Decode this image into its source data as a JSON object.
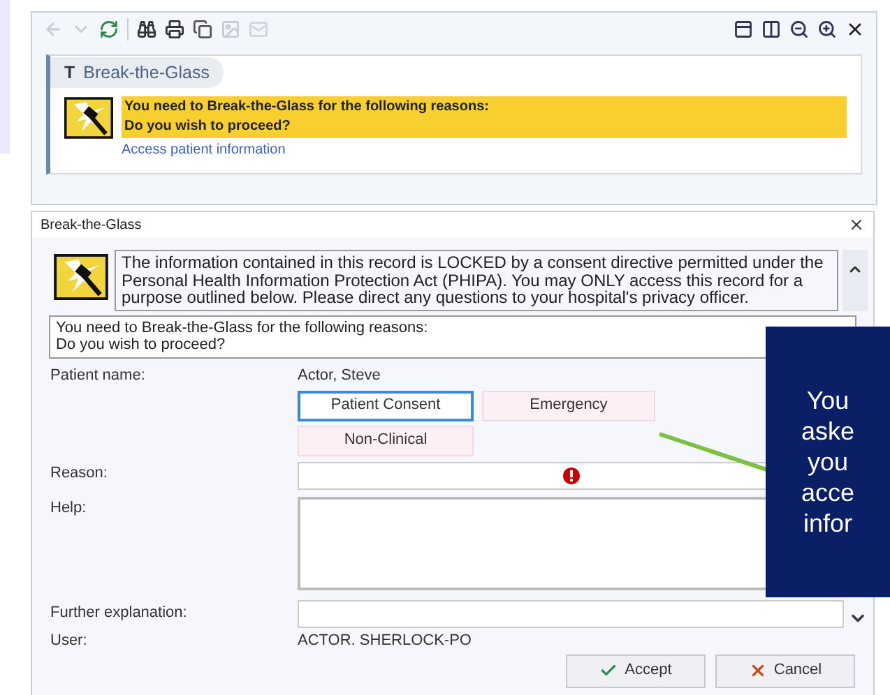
{
  "panel": {
    "title_icon": "T",
    "title": "Break-the-Glass",
    "banner": [
      "You need to Break-the-Glass for the following reasons:",
      "Do you wish to proceed?"
    ],
    "link": "Access patient information"
  },
  "dialog": {
    "title": "Break-the-Glass",
    "notice": "The information contained in this record is LOCKED by a consent directive permitted under the Personal Health Information Protection Act (PHIPA). You may ONLY access this record for a purpose outlined below. Please direct any questions to your hospital's privacy officer.",
    "reasons": [
      "You need to Break-the-Glass for the following reasons:",
      "Do you wish to proceed?"
    ],
    "fields": [
      {
        "kind": "text",
        "label": "Patient name:",
        "value": "Actor, Steve"
      },
      {
        "kind": "choices",
        "options": [
          {
            "label": "Patient Consent",
            "selected": true
          },
          {
            "label": "Emergency",
            "selected": false
          },
          {
            "label": "Non-Clinical",
            "selected": false
          }
        ]
      },
      {
        "kind": "reason",
        "label": "Reason:",
        "error": true
      },
      {
        "kind": "textarea",
        "label": "Help:"
      },
      {
        "kind": "dropdown",
        "label": "Further explanation:"
      },
      {
        "kind": "text",
        "label": "User:",
        "value": "ACTOR. SHERLOCK-PO"
      }
    ],
    "buttons": [
      {
        "kind": "accept",
        "label": "Accept"
      },
      {
        "kind": "cancel",
        "label": "Cancel"
      }
    ]
  },
  "callout": {
    "lines": [
      "You",
      "aske",
      "you",
      "acce",
      "infor"
    ]
  }
}
